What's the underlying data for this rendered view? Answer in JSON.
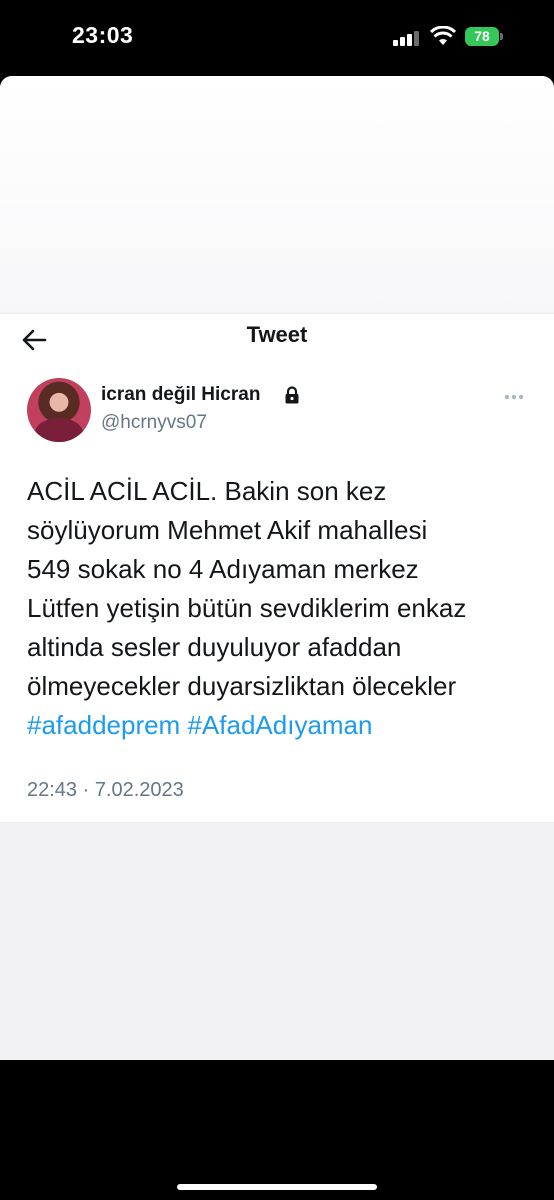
{
  "status_bar": {
    "time": "23:03",
    "battery": "78",
    "icons": [
      "signal-icon",
      "wifi-icon",
      "battery-icon"
    ]
  },
  "header": {
    "title": "Tweet",
    "back_icon": "arrow-left-icon"
  },
  "tweet": {
    "display_name": "icran değil Hicran",
    "handle": "@hcrnyvs07",
    "lines": [
      "ACİL ACİL ACİL.  Bakin son kez",
      "söylüyorum Mehmet Akif mahallesi",
      "549 sokak no 4 Adıyaman merkez",
      "Lütfen yetişin bütün sevdiklerim enkaz",
      "altinda sesler duyuluyor afaddan",
      "ölmeyecekler duyarsizliktan ölecekler"
    ],
    "hashtags": [
      "#afaddeprem",
      "#AfadAdıyaman"
    ],
    "timestamp": "22:43 · 7.02.2023"
  },
  "colors": {
    "link": "#1d9bf0",
    "secondary_text": "#657786",
    "battery": "#34c759"
  }
}
